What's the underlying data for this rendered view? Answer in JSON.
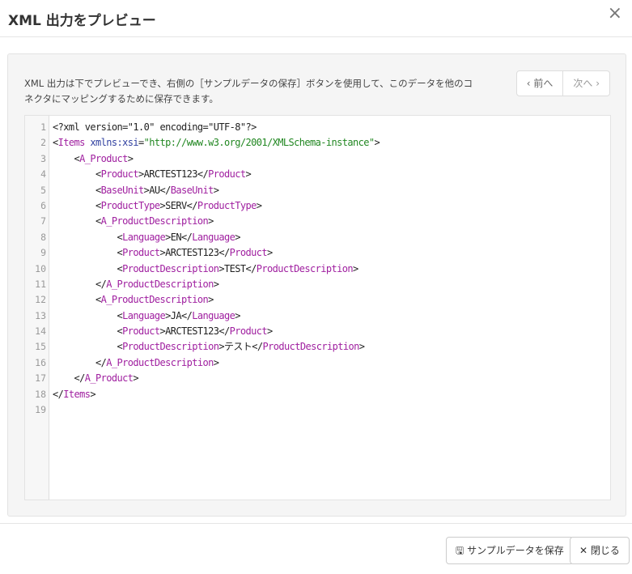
{
  "dialog": {
    "title": "XML 出力をプレビュー",
    "close_icon": "×"
  },
  "description": "XML 出力は下でプレビューでき、右側の［サンプルデータの保存］ボタンを使用して、このデータを他のコネクタにマッピングするために保存できます。",
  "nav": {
    "prev": "‹ 前へ",
    "next": "次へ ›"
  },
  "code_lines": [
    [
      [
        "txt",
        "<?xml version=\"1.0\" encoding=\"UTF-8\"?>"
      ]
    ],
    [
      [
        "txt",
        "<"
      ],
      [
        "tag",
        "Items"
      ],
      [
        "txt",
        " "
      ],
      [
        "attr",
        "xmlns:xsi"
      ],
      [
        "txt",
        "="
      ],
      [
        "str",
        "\"http://www.w3.org/2001/XMLSchema-instance\""
      ],
      [
        "txt",
        ">"
      ]
    ],
    [
      [
        "txt",
        "    <"
      ],
      [
        "tag",
        "A_Product"
      ],
      [
        "txt",
        ">"
      ]
    ],
    [
      [
        "txt",
        "        <"
      ],
      [
        "tag",
        "Product"
      ],
      [
        "txt",
        ">ARCTEST123</"
      ],
      [
        "tag",
        "Product"
      ],
      [
        "txt",
        ">"
      ]
    ],
    [
      [
        "txt",
        "        <"
      ],
      [
        "tag",
        "BaseUnit"
      ],
      [
        "txt",
        ">AU</"
      ],
      [
        "tag",
        "BaseUnit"
      ],
      [
        "txt",
        ">"
      ]
    ],
    [
      [
        "txt",
        "        <"
      ],
      [
        "tag",
        "ProductType"
      ],
      [
        "txt",
        ">SERV</"
      ],
      [
        "tag",
        "ProductType"
      ],
      [
        "txt",
        ">"
      ]
    ],
    [
      [
        "txt",
        "        <"
      ],
      [
        "tag",
        "A_ProductDescription"
      ],
      [
        "txt",
        ">"
      ]
    ],
    [
      [
        "txt",
        "            <"
      ],
      [
        "tag",
        "Language"
      ],
      [
        "txt",
        ">EN</"
      ],
      [
        "tag",
        "Language"
      ],
      [
        "txt",
        ">"
      ]
    ],
    [
      [
        "txt",
        "            <"
      ],
      [
        "tag",
        "Product"
      ],
      [
        "txt",
        ">ARCTEST123</"
      ],
      [
        "tag",
        "Product"
      ],
      [
        "txt",
        ">"
      ]
    ],
    [
      [
        "txt",
        "            <"
      ],
      [
        "tag",
        "ProductDescription"
      ],
      [
        "txt",
        ">TEST</"
      ],
      [
        "tag",
        "ProductDescription"
      ],
      [
        "txt",
        ">"
      ]
    ],
    [
      [
        "txt",
        "        </"
      ],
      [
        "tag",
        "A_ProductDescription"
      ],
      [
        "txt",
        ">"
      ]
    ],
    [
      [
        "txt",
        "        <"
      ],
      [
        "tag",
        "A_ProductDescription"
      ],
      [
        "txt",
        ">"
      ]
    ],
    [
      [
        "txt",
        "            <"
      ],
      [
        "tag",
        "Language"
      ],
      [
        "txt",
        ">JA</"
      ],
      [
        "tag",
        "Language"
      ],
      [
        "txt",
        ">"
      ]
    ],
    [
      [
        "txt",
        "            <"
      ],
      [
        "tag",
        "Product"
      ],
      [
        "txt",
        ">ARCTEST123</"
      ],
      [
        "tag",
        "Product"
      ],
      [
        "txt",
        ">"
      ]
    ],
    [
      [
        "txt",
        "            <"
      ],
      [
        "tag",
        "ProductDescription"
      ],
      [
        "txt",
        ">テスト</"
      ],
      [
        "tag",
        "ProductDescription"
      ],
      [
        "txt",
        ">"
      ]
    ],
    [
      [
        "txt",
        "        </"
      ],
      [
        "tag",
        "A_ProductDescription"
      ],
      [
        "txt",
        ">"
      ]
    ],
    [
      [
        "txt",
        "    </"
      ],
      [
        "tag",
        "A_Product"
      ],
      [
        "txt",
        ">"
      ]
    ],
    [
      [
        "txt",
        "</"
      ],
      [
        "tag",
        "Items"
      ],
      [
        "txt",
        ">"
      ]
    ],
    []
  ],
  "footer": {
    "save_label": "サンプルデータを保存",
    "close_label": "閉じる",
    "save_icon": "🖫",
    "close_icon": "✕"
  }
}
